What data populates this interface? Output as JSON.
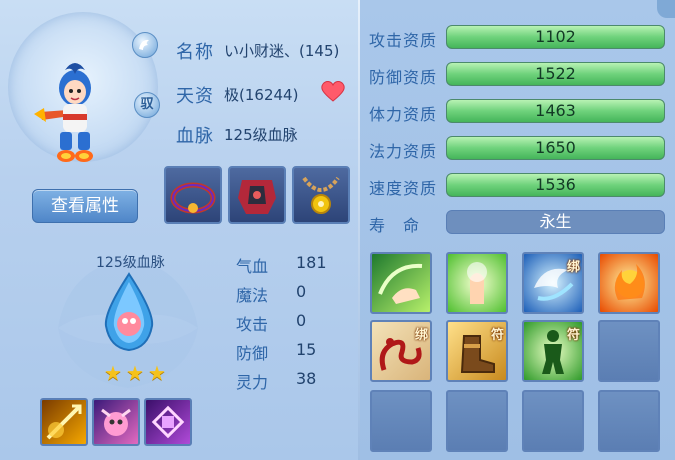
{
  "pet": {
    "name_label": "名称",
    "name_value": "い小财迷、(145)",
    "talent_label": "天资",
    "talent_value": "极(16244)",
    "bloodline_label": "血脉",
    "bloodline_value": "125级血脉",
    "round_btn_1": "",
    "round_btn_2": "驭"
  },
  "buttons": {
    "view_attributes": "查看属性"
  },
  "bloodline_panel": {
    "title": "125级血脉",
    "stars": 3
  },
  "stats": [
    {
      "label": "气血",
      "value": "181"
    },
    {
      "label": "魔法",
      "value": "0"
    },
    {
      "label": "攻击",
      "value": "0"
    },
    {
      "label": "防御",
      "value": "15"
    },
    {
      "label": "灵力",
      "value": "38"
    }
  ],
  "aptitudes": [
    {
      "label": "攻击资质",
      "value": "1102",
      "fill": 1.0
    },
    {
      "label": "防御资质",
      "value": "1522",
      "fill": 1.0
    },
    {
      "label": "体力资质",
      "value": "1463",
      "fill": 1.0
    },
    {
      "label": "法力资质",
      "value": "1650",
      "fill": 1.0
    },
    {
      "label": "速度资质",
      "value": "1536",
      "fill": 1.0
    }
  ],
  "life": {
    "label": "寿　命",
    "value": "永生"
  },
  "skills": [
    {
      "icon": "hand-wind-skill-icon",
      "tag": ""
    },
    {
      "icon": "palm-light-skill-icon",
      "tag": ""
    },
    {
      "icon": "water-vortex-skill-icon",
      "tag": "绑"
    },
    {
      "icon": "fire-orb-skill-icon",
      "tag": ""
    },
    {
      "icon": "red-dragon-skill-icon",
      "tag": "绑"
    },
    {
      "icon": "boot-skill-icon",
      "tag": "符"
    },
    {
      "icon": "green-figure-skill-icon",
      "tag": "符"
    },
    {
      "icon": "empty-slot",
      "tag": ""
    },
    {
      "icon": "empty-slot",
      "tag": ""
    },
    {
      "icon": "empty-slot",
      "tag": ""
    },
    {
      "icon": "empty-slot",
      "tag": ""
    },
    {
      "icon": "empty-slot",
      "tag": ""
    }
  ],
  "colors": {
    "label_blue": "#2f66a8",
    "bar_green": "#6fd27c",
    "panel_bg": "#b7d0ee"
  }
}
